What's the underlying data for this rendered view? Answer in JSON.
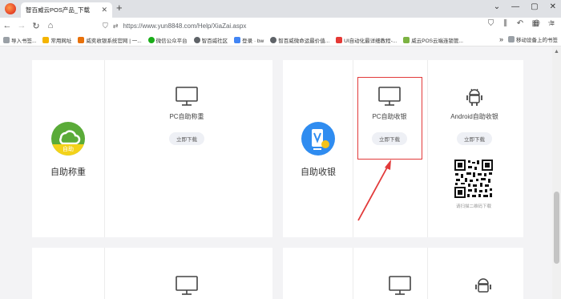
{
  "tab": {
    "title": "智百威云POS产品_下载"
  },
  "nav": {
    "url": "https://www.yun8848.com/Help/XiaZai.aspx"
  },
  "bookmarks": [
    {
      "label": "导入书签...",
      "color": "#9aa0a6"
    },
    {
      "label": "常用网址",
      "color": "#f4b400"
    },
    {
      "label": "威奕收银系统官网 | 一...",
      "color": "#e8710a"
    },
    {
      "label": "微信公众平台",
      "color": "#1aad19"
    },
    {
      "label": "智百威社区",
      "color": "#5f6368"
    },
    {
      "label": "登录 · bw",
      "color": "#4285f4"
    },
    {
      "label": "智百威微命运最价值...",
      "color": "#5f6368"
    },
    {
      "label": "UI自动化最详细教程-...",
      "color": "#e53935"
    },
    {
      "label": "威云POS云端连锁管...",
      "color": "#7cb342"
    }
  ],
  "bookmarks_right": {
    "mobile_label": "移动设备上的书签"
  },
  "cards": {
    "weigh": {
      "category_label": "自助称重",
      "badge": "自助",
      "product_name": "PC自助称重",
      "button_label": "立即下载"
    },
    "checkout": {
      "category_label": "自助收银",
      "pc_name": "PC自助收银",
      "pc_button": "立即下载",
      "android_name": "Android自助收银",
      "android_button": "立即下载",
      "qr_caption": "请扫描二维码下载"
    }
  },
  "colors": {
    "highlight": "#e23a3a",
    "arrow": "#e23a3a",
    "cloud_icon_bg": "#5aab38",
    "badge_bg": "#f3d21a",
    "kiosk_icon_bg": "#2f8cf0"
  },
  "icons": [
    "monitor-icon",
    "android-icon",
    "cloud-icon",
    "kiosk-icon",
    "qr-code"
  ]
}
